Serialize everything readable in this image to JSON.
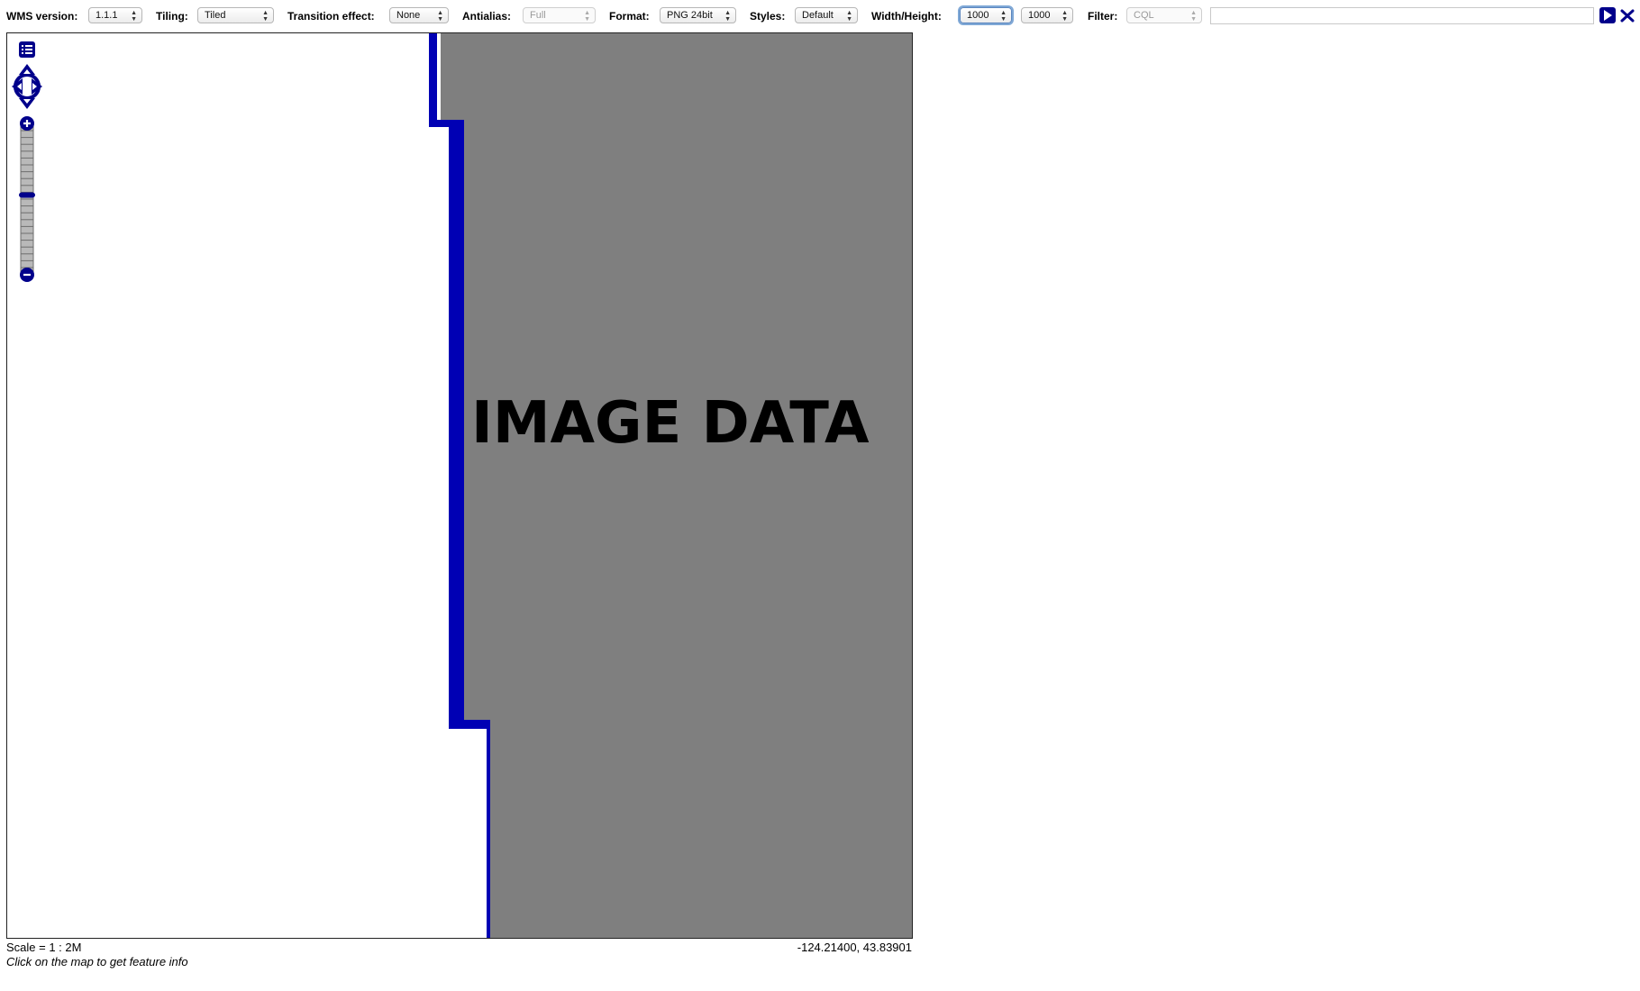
{
  "toolbar": {
    "wms_version": {
      "label": "WMS version:",
      "value": "1.1.1"
    },
    "tiling": {
      "label": "Tiling:",
      "value": "Tiled"
    },
    "transition": {
      "label": "Transition effect:",
      "value": "None"
    },
    "antialias": {
      "label": "Antialias:",
      "value": "Full"
    },
    "format": {
      "label": "Format:",
      "value": "PNG 24bit"
    },
    "styles": {
      "label": "Styles:",
      "value": "Default"
    },
    "size": {
      "label": "Width/Height:",
      "width": "1000",
      "height": "1000"
    },
    "filter": {
      "label": "Filter:",
      "type": "CQL",
      "value": ""
    }
  },
  "map": {
    "overlay_text": "IMAGE DATA",
    "zoom_level_fraction": 0.47
  },
  "status": {
    "scale": "Scale = 1 : 2M",
    "hint": "Click on the map to get feature info",
    "coordinates": "-124.21400, 43.83901"
  },
  "colors": {
    "accent": "#00008b",
    "boundary": "#0000b4",
    "image_fill": "#7f7f7f"
  },
  "icons": {
    "layer_switcher": "layer-switcher-icon",
    "pan": "pan-arrows-icon",
    "zoom_in": "zoom-in-icon",
    "zoom_out": "zoom-out-icon",
    "apply": "apply-filter-icon",
    "reset": "reset-filter-icon"
  }
}
